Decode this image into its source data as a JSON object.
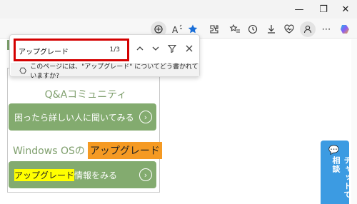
{
  "find_bar": {
    "query": "アップグレード",
    "match_count": "1/3",
    "suggestion": "このページには、\"アップグレード\" についてどう書かれていますか?"
  },
  "content": {
    "qa_title": "Q&Aコミュニティ",
    "ask_button": "困ったら詳しい人に聞いてみる",
    "os_prefix": "Windows OSの",
    "os_highlight": "アップグレード",
    "info_highlight": "アップグレード",
    "info_rest": "情報をみる"
  },
  "chat_button": {
    "label": "チャットで相談"
  },
  "colors": {
    "accent_green": "#83ab6f",
    "highlight_current": "#f59a23",
    "highlight_other": "#ffff00",
    "focus_box": "#d40000",
    "chat_blue": "#3c9be2"
  }
}
